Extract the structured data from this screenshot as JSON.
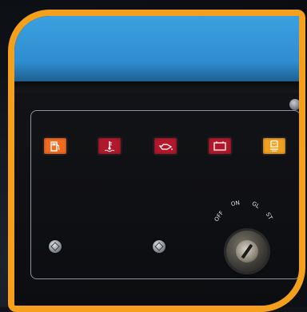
{
  "colors": {
    "frame": "#f5a01c",
    "top_band": "#3aa0e0",
    "panel_border": "#8e949c",
    "lamp_fuel": "#f26a1f",
    "lamp_coolant": "#b2182b",
    "lamp_oil": "#b2182b",
    "lamp_battery": "#b2182b",
    "lamp_glow": "#f0a01e"
  },
  "indicators": [
    {
      "name": "fuel",
      "icon": "fuel-pump-icon"
    },
    {
      "name": "coolant-temperature",
      "icon": "thermometer-icon"
    },
    {
      "name": "oil-pressure",
      "icon": "oil-can-icon"
    },
    {
      "name": "battery",
      "icon": "battery-icon"
    },
    {
      "name": "glow-plug",
      "icon": "glow-plug-icon"
    }
  ],
  "key_switch": {
    "positions": [
      "OFF",
      "ON",
      "GL",
      "ST"
    ]
  }
}
